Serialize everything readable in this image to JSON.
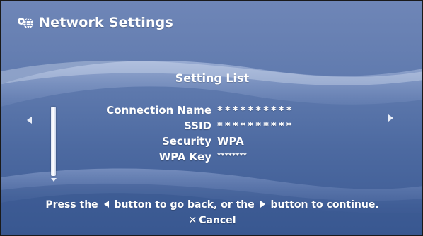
{
  "header": {
    "title": "Network Settings",
    "icon": "network-globe-icon"
  },
  "list": {
    "title": "Setting List",
    "rows": [
      {
        "label": "Connection Name",
        "value": "**********"
      },
      {
        "label": "SSID",
        "value": "**********"
      },
      {
        "label": "Security",
        "value": "WPA"
      },
      {
        "label": "WPA Key",
        "value": "********"
      }
    ]
  },
  "navigation": {
    "left_arrow_icon": "left-arrow-icon",
    "right_arrow_icon": "right-arrow-icon",
    "scroll_down_icon": "scroll-down-icon"
  },
  "footer": {
    "hint_part1": "Press the",
    "hint_part2": "button to go back, or the",
    "hint_part3": "button to continue.",
    "cancel_label": "Cancel",
    "cancel_icon": "cross-button-icon"
  },
  "colors": {
    "background_top": "#6f86b7",
    "background_bottom": "#3c5a93",
    "text": "#ffffff"
  }
}
